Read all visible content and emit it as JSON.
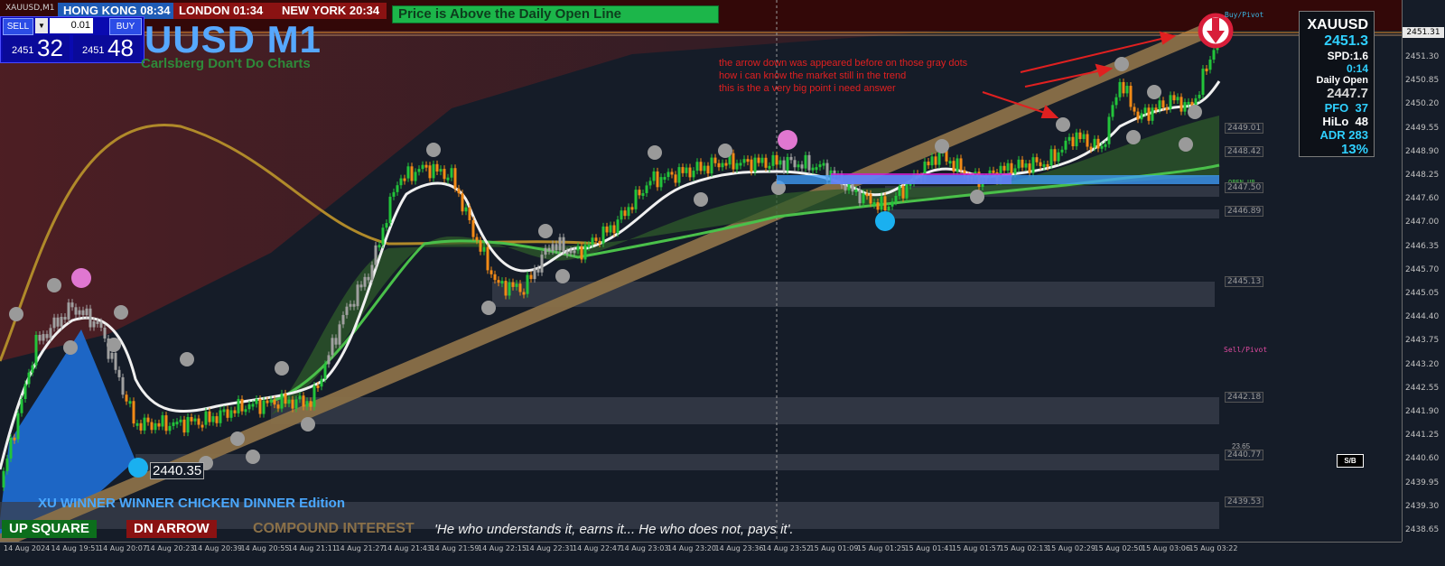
{
  "window_title": "XAUUSD,M1",
  "sessions": [
    {
      "name": "HONG KONG",
      "time": "08:34",
      "bg": "#1e5bb5"
    },
    {
      "name": "LONDON",
      "time": "01:34",
      "bg": "#8a1212"
    },
    {
      "name": "NEW YORK",
      "time": "20:34",
      "bg": "#8a1212"
    }
  ],
  "status_banner": "Price is Above the Daily Open Line",
  "trade_panel": {
    "sell_label": "SELL",
    "buy_label": "BUY",
    "lot": "0.01",
    "sell_small": "2451",
    "sell_big": "32",
    "buy_small": "2451",
    "buy_big": "48"
  },
  "symbol_title": "UUSD M1",
  "subtitle": "Carlsberg Don't Do Charts",
  "annotation": {
    "line1": "the arrow down was appeared before on those gray dots",
    "line2": "how i can know the market still in the trend",
    "line3": "this is the a very big point i need answer"
  },
  "info_box": {
    "symbol": "XAUUSD",
    "price": "2451.3",
    "spread": "SPD:1.6",
    "timer": "0:14",
    "daily_open_label": "Daily Open",
    "daily_open": "2447.7",
    "pfo_label": "PFO",
    "pfo": "37",
    "hilo_label": "HiLo",
    "hilo": "48",
    "adr_label": "ADR",
    "adr": "283",
    "pct": "13%"
  },
  "price_ticks": [
    "2451.30",
    "2450.85",
    "2450.20",
    "2449.55",
    "2448.90",
    "2448.25",
    "2447.60",
    "2447.00",
    "2446.35",
    "2445.70",
    "2445.05",
    "2444.40",
    "2443.75",
    "2443.20",
    "2442.55",
    "2441.90",
    "2441.25",
    "2440.60",
    "2439.95",
    "2439.30",
    "2438.65"
  ],
  "level_labels": [
    {
      "text": "2451.31",
      "kind": "current"
    },
    {
      "text": "2449.01"
    },
    {
      "text": "2448.42"
    },
    {
      "text": "2447.50"
    },
    {
      "text": "2446.89"
    },
    {
      "text": "2445.13"
    },
    {
      "text": "2442.18"
    },
    {
      "text": "2440.77"
    },
    {
      "text": "2439.53"
    }
  ],
  "small_labels": {
    "buy_pivot": "Buy/Pivot",
    "sell_pivot": "Sell/Pivot",
    "open_up": "OPEN UP",
    "low_value": "2440.35",
    "small_num": "23.65",
    "sb": "S/B"
  },
  "time_ticks": [
    "14 Aug 2024",
    "14 Aug 19:51",
    "14 Aug 20:07",
    "14 Aug 20:23",
    "14 Aug 20:39",
    "14 Aug 20:55",
    "14 Aug 21:11",
    "14 Aug 21:27",
    "14 Aug 21:43",
    "14 Aug 21:59",
    "14 Aug 22:15",
    "14 Aug 22:31",
    "14 Aug 22:47",
    "14 Aug 23:03",
    "14 Aug 23:20",
    "14 Aug 23:36",
    "14 Aug 23:52",
    "15 Aug 01:09",
    "15 Aug 01:25",
    "15 Aug 01:41",
    "15 Aug 01:57",
    "15 Aug 02:13",
    "15 Aug 02:29",
    "15 Aug 02:50",
    "15 Aug 03:06",
    "15 Aug 03:22"
  ],
  "edition": "XU WINNER WINNER CHICKEN DINNER Edition",
  "bottom": {
    "up_square": "UP SQUARE",
    "dn_arrow": "DN ARROW",
    "compound": "COMPOUND INTEREST",
    "quote": "'He who understands it, earns it... He who does not, pays it'."
  },
  "colors": {
    "background": "#151c28",
    "bull_candle": "#22c43a",
    "bear_candle": "#f28a16",
    "neutral_candle": "#a0a0a0",
    "trend_line": "#7a6440",
    "zone": "#3a3f4c",
    "annotation": "#e02020",
    "info_cyan": "#2fd0ff"
  },
  "icons": [
    "down-arrow-circle-icon",
    "gray-dot-marker-icon",
    "cyan-dot-marker-icon",
    "pink-dot-marker-icon",
    "dropdown-icon"
  ]
}
